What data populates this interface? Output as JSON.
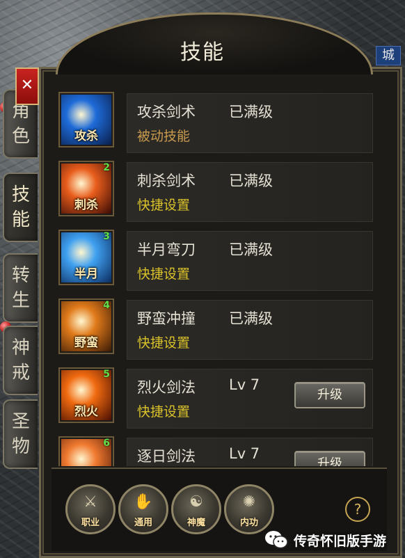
{
  "title": "技能",
  "city_badge": "城",
  "side_tabs": [
    {
      "label": "角色",
      "active": false
    },
    {
      "label": "技能",
      "active": true
    },
    {
      "label": "转生",
      "active": false
    },
    {
      "label": "神戒",
      "active": false
    },
    {
      "label": "圣物",
      "active": false
    }
  ],
  "close_label": "✕",
  "skills": [
    {
      "name": "攻杀剑术",
      "level": "已满级",
      "sub": "被动技能",
      "sub_type": "passive",
      "hotkey": "",
      "glyph": "攻杀",
      "colors": [
        "#1e6bd8",
        "#0a1f4c"
      ],
      "upgrade": ""
    },
    {
      "name": "刺杀剑术",
      "level": "已满级",
      "sub": "快捷设置",
      "sub_type": "shortcut",
      "hotkey": "2",
      "glyph": "刺杀",
      "colors": [
        "#e85d1c",
        "#3a0b05"
      ],
      "upgrade": ""
    },
    {
      "name": "半月弯刀",
      "level": "已满级",
      "sub": "快捷设置",
      "sub_type": "shortcut",
      "hotkey": "3",
      "glyph": "半月",
      "colors": [
        "#3fa0f0",
        "#0b2b5e"
      ],
      "upgrade": ""
    },
    {
      "name": "野蛮冲撞",
      "level": "已满级",
      "sub": "快捷设置",
      "sub_type": "shortcut",
      "hotkey": "4",
      "glyph": "野蛮",
      "colors": [
        "#e07a1a",
        "#3a1a05"
      ],
      "upgrade": ""
    },
    {
      "name": "烈火剑法",
      "level": "Lv 7",
      "sub": "快捷设置",
      "sub_type": "shortcut",
      "hotkey": "5",
      "glyph": "烈火",
      "colors": [
        "#f06a10",
        "#4a0f02"
      ],
      "upgrade": "升级"
    },
    {
      "name": "逐日剑法",
      "level": "Lv 7",
      "sub": "",
      "sub_type": "shortcut",
      "hotkey": "6",
      "glyph": "",
      "colors": [
        "#f07a30",
        "#4a1505"
      ],
      "upgrade": "升级"
    }
  ],
  "categories": [
    {
      "label": "职业",
      "symbol": "⚔"
    },
    {
      "label": "通用",
      "symbol": "✋"
    },
    {
      "label": "神魔",
      "symbol": "☯"
    },
    {
      "label": "内功",
      "symbol": "✺"
    }
  ],
  "help_label": "?",
  "watermark": "传奇怀旧版手游"
}
